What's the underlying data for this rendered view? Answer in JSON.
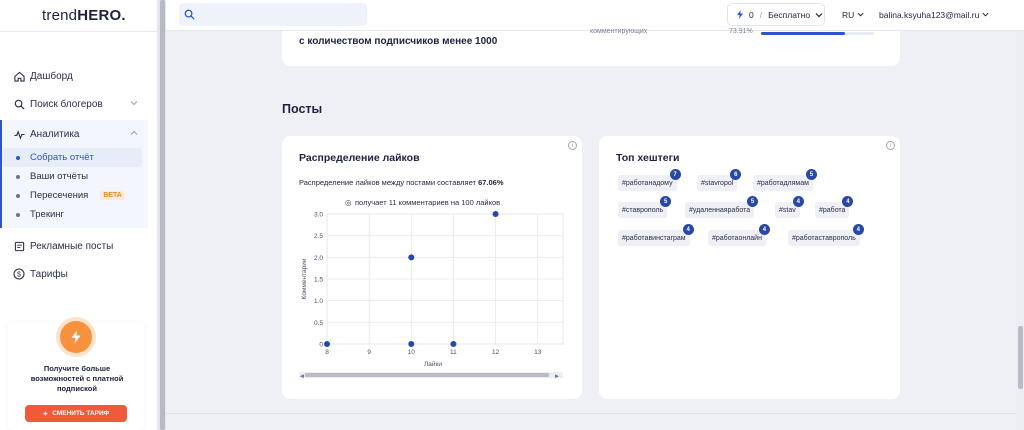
{
  "app": {
    "logo_light": "trend",
    "logo_bold": "HERO."
  },
  "topbar": {
    "search_placeholder": "",
    "credits_value": "0",
    "credits_sep": "/",
    "plan": "Бесплатно",
    "lang": "RU",
    "email": "balina.ksyuha123@mail.ru"
  },
  "sidebar": {
    "dashboard": "Дашборд",
    "search_bloggers": "Поиск блогеров",
    "analytics": "Аналитика",
    "sub": {
      "collect": "Собрать отчёт",
      "reports": "Ваши отчёты",
      "intersections": "Пересечения",
      "beta": "BETA",
      "tracking": "Трекинг"
    },
    "ads": "Рекламные посты",
    "tariffs": "Тарифы",
    "upgrade_text": "Получите больше возможностей с платной подпиской",
    "upgrade_button": "СМЕНИТЬ ТАРИФ"
  },
  "top_card": {
    "subtitle": "с количеством подписчиков менее 1000",
    "comment_label": "комментирующих",
    "pct": "73.91%",
    "fill": 0.74
  },
  "posts": {
    "section_title": "Посты",
    "likes_card": {
      "title": "Распределение лайков",
      "dist_text": "Распределение лайков между постами составляет",
      "dist_value": "67.06%"
    },
    "tags_card": {
      "title": "Топ хештеги",
      "tags": [
        {
          "name": "#работанадому",
          "count": "7"
        },
        {
          "name": "#stavropol",
          "count": "6"
        },
        {
          "name": "#работадлямам",
          "count": "5"
        },
        {
          "name": "#ставрополь",
          "count": "5"
        },
        {
          "name": "#удаленнаяработа",
          "count": "5"
        },
        {
          "name": "#stav",
          "count": "4"
        },
        {
          "name": "#работа",
          "count": "4"
        },
        {
          "name": "#работавинстаграм",
          "count": "4"
        },
        {
          "name": "#работаонлайн",
          "count": "4"
        },
        {
          "name": "#работаставрополь",
          "count": "4"
        }
      ]
    }
  },
  "colors": {
    "accent": "#2d55c8",
    "orange": "#f7913d",
    "button": "#f05a3b"
  },
  "chart_data": {
    "type": "scatter",
    "title": "получает 11 комментариев на 100 лайков",
    "xlabel": "Лайки",
    "ylabel": "Комментарии",
    "x_ticks": [
      "8",
      "9",
      "10",
      "11",
      "12",
      "13"
    ],
    "y_ticks": [
      "0",
      "0.5",
      "1.0",
      "1.5",
      "2.0",
      "2.5",
      "3.0"
    ],
    "xlim": [
      8,
      13.6
    ],
    "ylim": [
      0,
      3
    ],
    "grid": true,
    "points": [
      {
        "x": 8,
        "y": 0
      },
      {
        "x": 10,
        "y": 0
      },
      {
        "x": 10,
        "y": 2
      },
      {
        "x": 11,
        "y": 0
      },
      {
        "x": 12,
        "y": 3
      }
    ]
  }
}
